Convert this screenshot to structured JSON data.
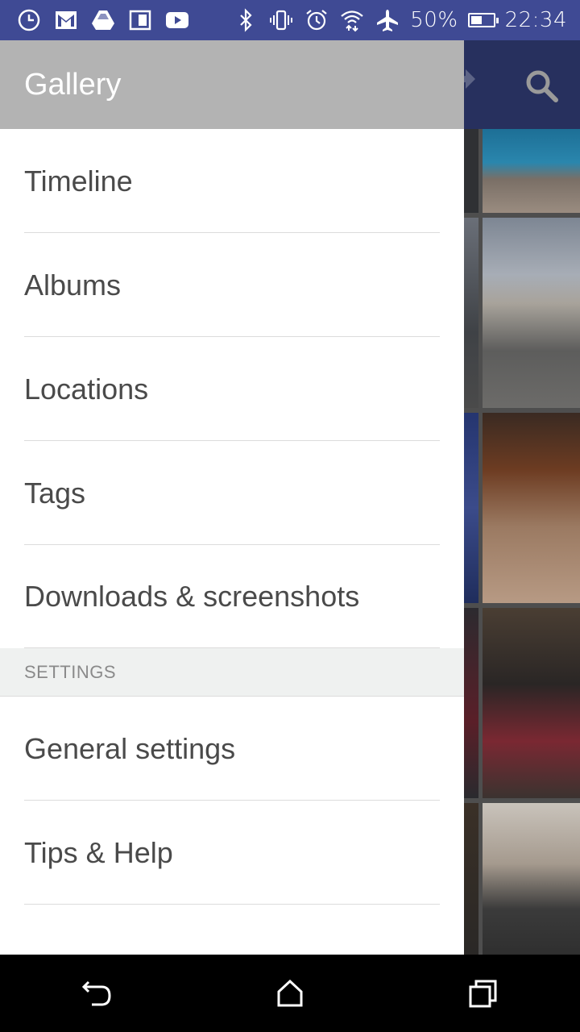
{
  "status_bar": {
    "left_icons": [
      "clock-icon",
      "gmail-icon",
      "drive-icon",
      "dual-screen-icon",
      "youtube-icon"
    ],
    "right_icons": [
      "bluetooth-icon",
      "vibrate-icon",
      "alarm-icon",
      "wifi-icon",
      "airplane-icon"
    ],
    "battery_percent": "50%",
    "battery_level": 0.5,
    "time": "22:34",
    "background": "#3f4a94"
  },
  "drawer": {
    "title": "Gallery",
    "items": [
      {
        "label": "Timeline"
      },
      {
        "label": "Albums"
      },
      {
        "label": "Locations"
      },
      {
        "label": "Tags"
      },
      {
        "label": "Downloads & screenshots"
      }
    ],
    "settings_header": "SETTINGS",
    "settings_items": [
      {
        "label": "General settings"
      },
      {
        "label": "Tips & Help"
      }
    ]
  },
  "app_bar": {
    "icons": [
      "share-icon",
      "search-icon"
    ]
  },
  "nav_bar": {
    "icons": [
      "back-icon",
      "home-icon",
      "recent-apps-icon"
    ]
  }
}
